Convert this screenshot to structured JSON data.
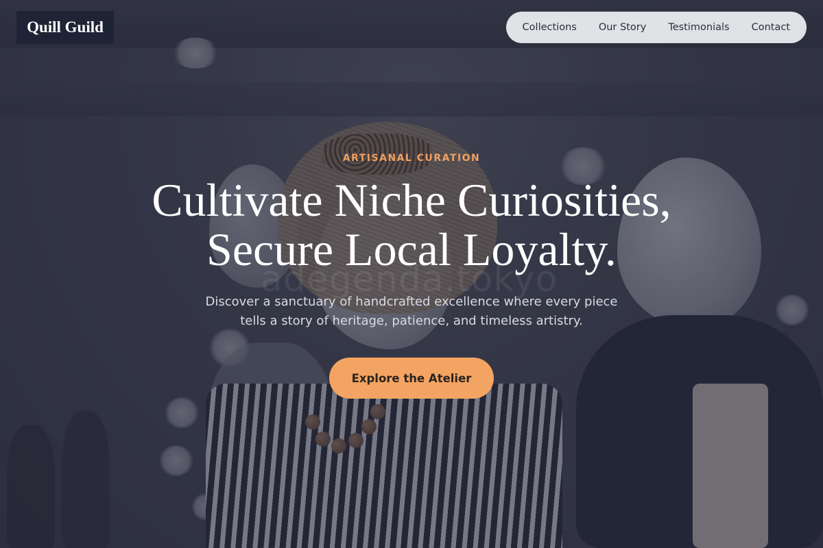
{
  "brand": {
    "logo_text": "Quill Guild",
    "logo_bg": "#1e2435"
  },
  "nav": {
    "items": [
      {
        "label": "Collections"
      },
      {
        "label": "Our Story"
      },
      {
        "label": "Testimonials"
      },
      {
        "label": "Contact"
      }
    ]
  },
  "hero": {
    "eyebrow": "ARTISANAL CURATION",
    "headline_line1": "Cultivate Niche Curiosities,",
    "headline_line2": "Secure Local Loyalty.",
    "subtext_line1": "Discover a sanctuary of handcrafted excellence where every piece",
    "subtext_line2": "tells a story of heritage, patience, and timeless artistry.",
    "cta_label": "Explore the Atelier",
    "background_watermark": "adegenda.tokyo"
  },
  "colors": {
    "accent": "#f4a462",
    "eyebrow": "#f0a060",
    "overlay": "rgba(40, 42, 58, 0.55)",
    "nav_bg": "#ecedf0"
  }
}
